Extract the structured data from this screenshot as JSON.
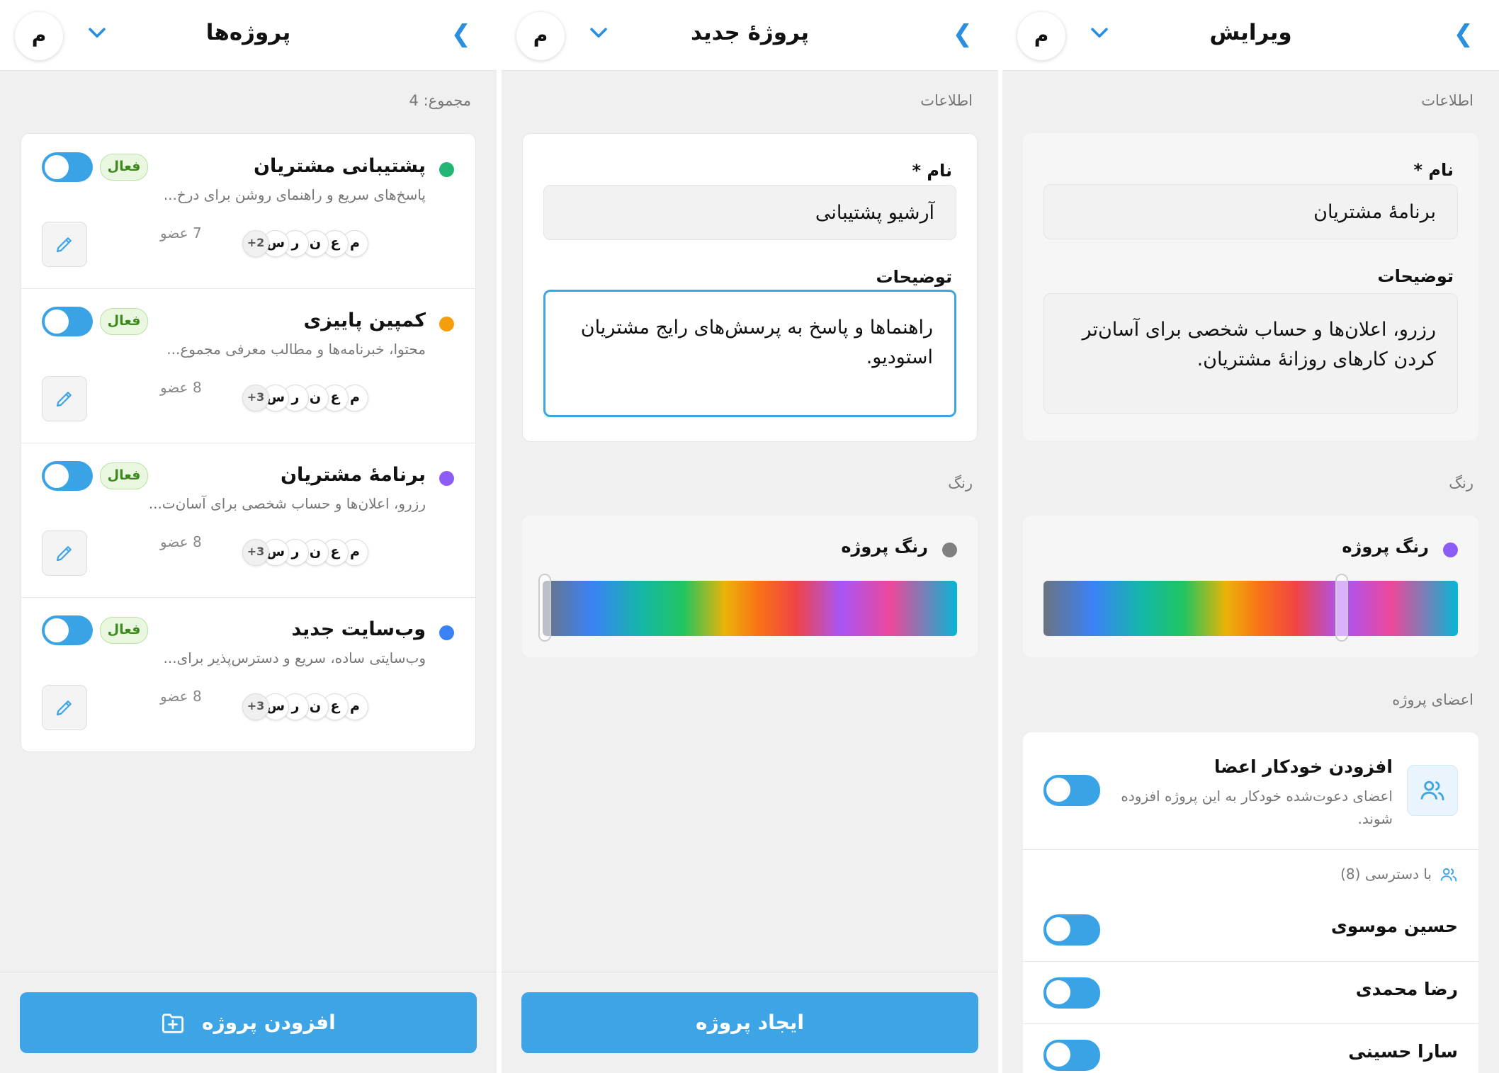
{
  "projects_panel": {
    "header": {
      "title": "پروژه‌ها",
      "avatar_letter": "م"
    },
    "total_label": "مجموع: 4",
    "projects": [
      {
        "name": "پشتیبانی مشتریان",
        "description": "پاسخ‌های سریع و راهنمای روشن برای درخ...",
        "status": "فعال",
        "members": "7 عضو",
        "avatars": [
          "م",
          "ع",
          "ن",
          "ر",
          "س"
        ],
        "more": "2+",
        "color": "#22b573"
      },
      {
        "name": "کمپین پاییزی",
        "description": "محتوا، خبرنامه‌ها و مطالب معرفی مجموع...",
        "status": "فعال",
        "members": "8 عضو",
        "avatars": [
          "م",
          "ع",
          "ن",
          "ر",
          "س"
        ],
        "more": "3+",
        "color": "#f59e0b"
      },
      {
        "name": "برنامهٔ مشتریان",
        "description": "رزرو، اعلان‌ها و حساب شخصی برای آسان‌ت...",
        "status": "فعال",
        "members": "8 عضو",
        "avatars": [
          "م",
          "ع",
          "ن",
          "ر",
          "س"
        ],
        "more": "3+",
        "color": "#8b5cf6"
      },
      {
        "name": "وب‌سایت جدید",
        "description": "وب‌سایتی ساده، سریع و دسترس‌پذیر برای...",
        "status": "فعال",
        "members": "8 عضو",
        "avatars": [
          "م",
          "ع",
          "ن",
          "ر",
          "س"
        ],
        "more": "3+",
        "color": "#3b82f6"
      }
    ],
    "add_button_label": "افزودن پروژه"
  },
  "new_project_panel": {
    "header": {
      "title": "پروژهٔ جدید",
      "avatar_letter": "م"
    },
    "info_section": "اطلاعات",
    "name_label": "نام *",
    "name_value": "آرشیو پشتیبانی",
    "description_label": "توضیحات",
    "description_value": "راهنماها و پاسخ به پرسش‌های رایج مشتریان استودیو.",
    "color_section": "رنگ",
    "color_label": "رنگ پروژه",
    "selected_color": "#808080",
    "slider_fraction": 0.0,
    "create_button_label": "ایجاد پروژه"
  },
  "edit_panel": {
    "header": {
      "title": "ویرایش",
      "avatar_letter": "م"
    },
    "info_section": "اطلاعات",
    "name_label": "نام *",
    "name_value": "برنامهٔ مشتریان",
    "description_label": "توضیحات",
    "description_value": "رزرو، اعلان‌ها و حساب شخصی برای آسان‌تر کردن کارهای روزانهٔ مشتریان.",
    "color_section": "رنگ",
    "color_label": "رنگ پروژه",
    "selected_color": "#8b5cf6",
    "slider_fraction": 0.72,
    "members_section": "اعضای پروژه",
    "auto_add_title": "افزودن خودکار اعضا",
    "auto_add_desc": "اعضای دعوت‌شده خودکار به این پروژه افزوده شوند.",
    "access_label": "با دسترسی (8)",
    "members": [
      "حسین موسوی",
      "رضا محمدی",
      "سارا حسینی"
    ]
  },
  "colors": {
    "accent": "#3da4e5",
    "badge_bg": "#e9f7e1",
    "badge_text": "#3c8a1c"
  }
}
